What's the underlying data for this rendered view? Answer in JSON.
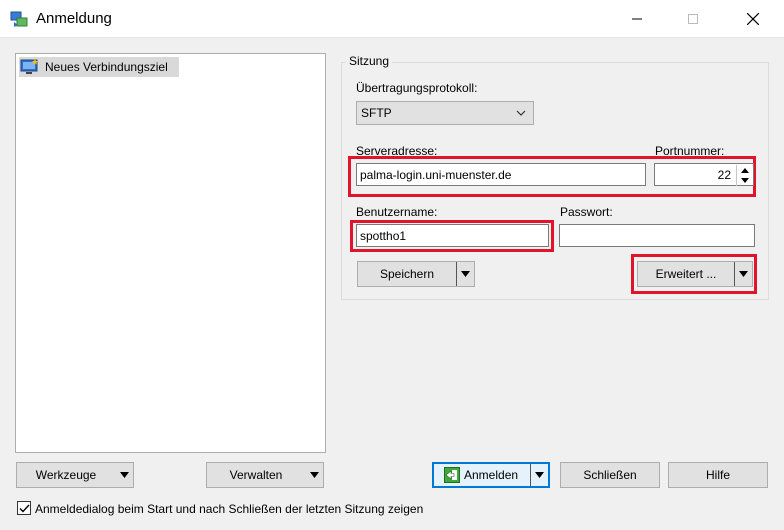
{
  "window": {
    "title": "Anmeldung"
  },
  "sites": {
    "items": [
      {
        "label": "Neues Verbindungsziel"
      }
    ]
  },
  "session": {
    "group_title": "Sitzung",
    "protocol_label": "Übertragungsprotokoll:",
    "protocol_value": "SFTP",
    "host_label": "Serveradresse:",
    "host_value": "palma-login.uni-muenster.de",
    "port_label": "Portnummer:",
    "port_value": "22",
    "user_label": "Benutzername:",
    "user_value": "spottho1",
    "password_label": "Passwort:",
    "password_value": "",
    "save_button": "Speichern",
    "advanced_button": "Erweitert ..."
  },
  "footer": {
    "tools_button": "Werkzeuge",
    "manage_button": "Verwalten",
    "login_button": "Anmelden",
    "close_button": "Schließen",
    "help_button": "Hilfe",
    "show_dialog_checkbox_label": "Anmeldedialog beim Start und nach Schließen der letzten Sitzung zeigen",
    "show_dialog_checked": true
  },
  "colors": {
    "highlight": "#e0142a",
    "default_button_border": "#0078d7"
  }
}
